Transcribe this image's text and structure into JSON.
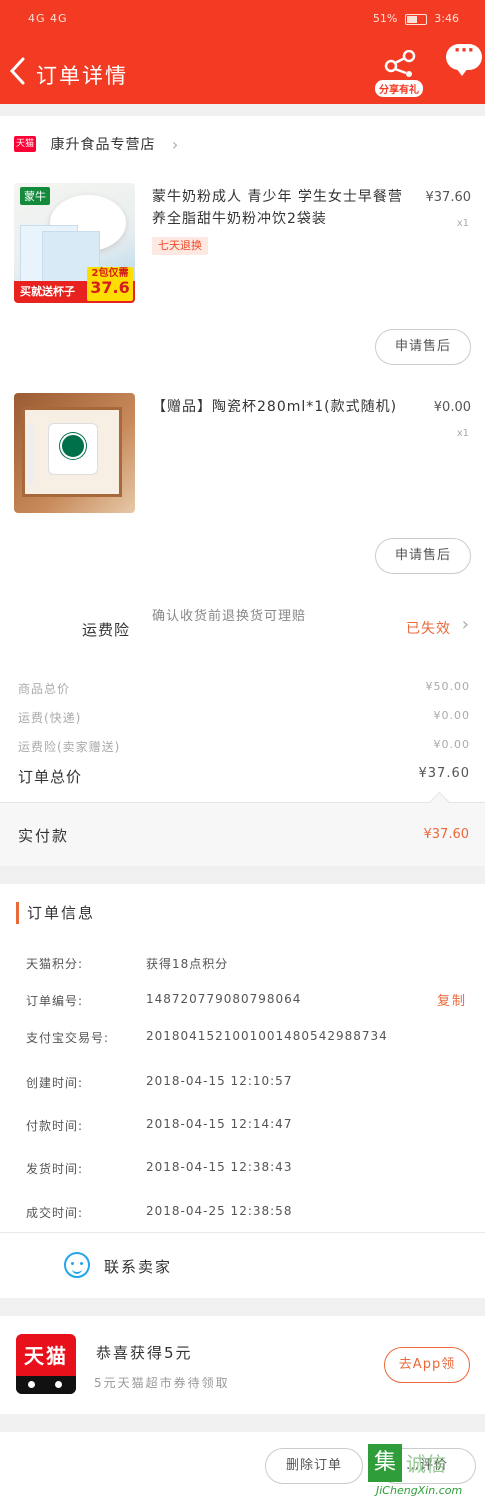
{
  "status_bar": {
    "left": "4G 4G",
    "battery": "51%",
    "time": "3:46"
  },
  "header": {
    "title": "订单详情",
    "share_label": "分享有礼",
    "more_label": "···"
  },
  "store": {
    "badge": "天猫",
    "name": "康升食品专营店"
  },
  "items": [
    {
      "title": "蒙牛奶粉成人 青少年 学生女士早餐营养全脂甜牛奶粉冲饮2袋装",
      "price": "¥37.60",
      "qty": "x1",
      "tag": "七天退换",
      "thumb_brand": "蒙牛",
      "thumb_promo": "买就送杯子",
      "thumb_price_line1": "2包仅需",
      "thumb_price_line2": "37.6",
      "after_sale": "申请售后"
    },
    {
      "title": "【赠品】陶瓷杯280ml*1(款式随机)",
      "price": "¥0.00",
      "qty": "x1",
      "after_sale": "申请售后"
    }
  ],
  "insurance": {
    "label": "运费险",
    "desc": "确认收货前退换货可理赔",
    "status": "已失效"
  },
  "summary": [
    {
      "label": "商品总价",
      "value": "¥50.00"
    },
    {
      "label": "运费(快递)",
      "value": "¥0.00"
    },
    {
      "label": "运费险(卖家赠送)",
      "value": "¥0.00"
    }
  ],
  "order_total": {
    "label": "订单总价",
    "value": "¥37.60"
  },
  "paid": {
    "label": "实付款",
    "value": "¥37.60"
  },
  "order_info": {
    "heading": "订单信息",
    "copy_label": "复制",
    "rows": [
      {
        "key": "天猫积分:",
        "value": "获得18点积分"
      },
      {
        "key": "订单编号:",
        "value": "148720779080798064"
      },
      {
        "key": "支付宝交易号:",
        "value": "2018041521001001480542988734"
      },
      {
        "key": "创建时间:",
        "value": "2018-04-15 12:10:57"
      },
      {
        "key": "付款时间:",
        "value": "2018-04-15 12:14:47"
      },
      {
        "key": "发货时间:",
        "value": "2018-04-15 12:38:43"
      },
      {
        "key": "成交时间:",
        "value": "2018-04-25 12:38:58"
      }
    ]
  },
  "contact": {
    "label": "联系卖家"
  },
  "promo": {
    "logo_text": "天猫",
    "title": "恭喜获得5元",
    "desc": "5元天猫超市券待领取",
    "button": "去App领"
  },
  "footer": {
    "delete_label": "删除订单",
    "other_label": "…评价"
  },
  "watermark": {
    "box": "集",
    "text": "诚信",
    "url": "JiChengXin.com"
  },
  "colors": {
    "brand": "#f33a23",
    "accent": "#e9693b",
    "tmall": "#ff0036"
  }
}
